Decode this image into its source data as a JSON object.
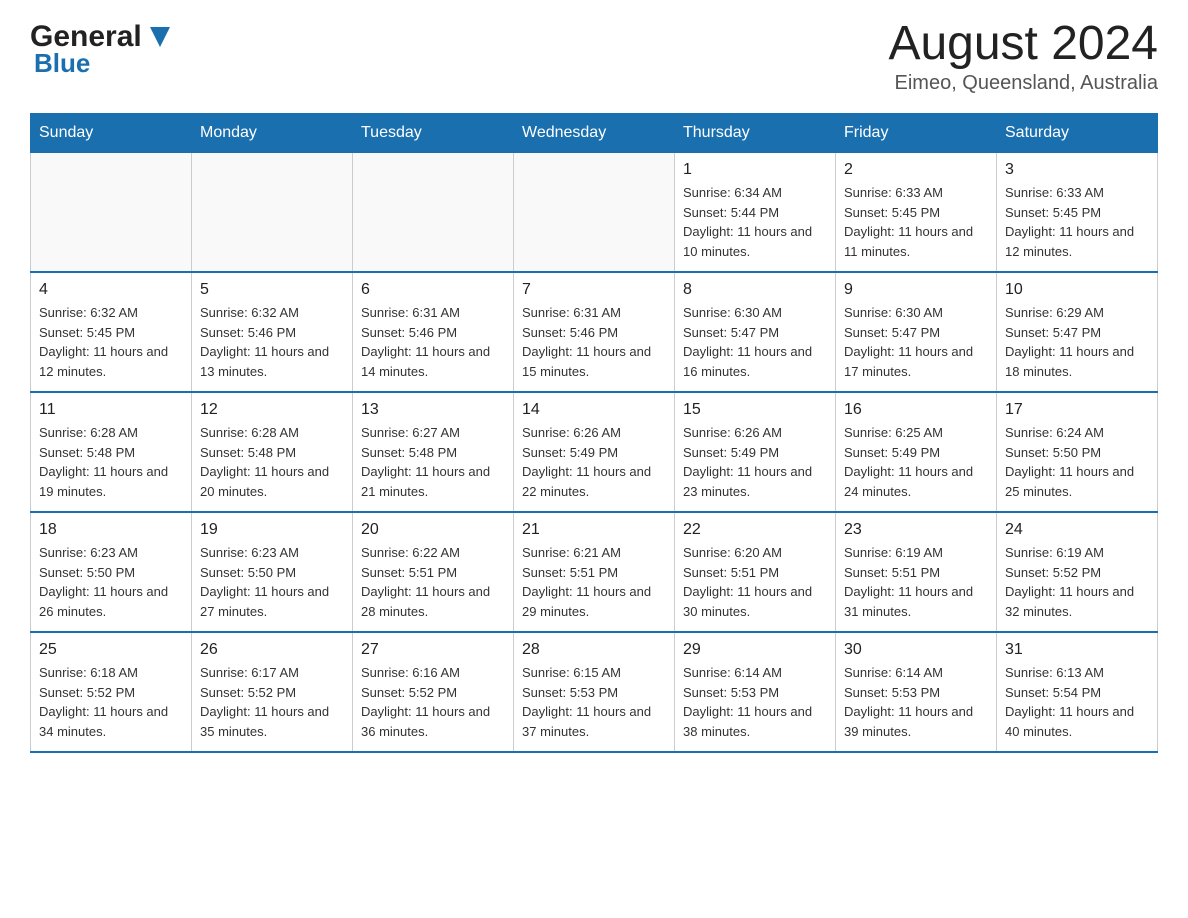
{
  "header": {
    "logo_general": "General",
    "logo_blue": "Blue",
    "month_title": "August 2024",
    "location": "Eimeo, Queensland, Australia"
  },
  "days_of_week": [
    "Sunday",
    "Monday",
    "Tuesday",
    "Wednesday",
    "Thursday",
    "Friday",
    "Saturday"
  ],
  "weeks": [
    {
      "days": [
        {
          "num": "",
          "info": ""
        },
        {
          "num": "",
          "info": ""
        },
        {
          "num": "",
          "info": ""
        },
        {
          "num": "",
          "info": ""
        },
        {
          "num": "1",
          "info": "Sunrise: 6:34 AM\nSunset: 5:44 PM\nDaylight: 11 hours and 10 minutes."
        },
        {
          "num": "2",
          "info": "Sunrise: 6:33 AM\nSunset: 5:45 PM\nDaylight: 11 hours and 11 minutes."
        },
        {
          "num": "3",
          "info": "Sunrise: 6:33 AM\nSunset: 5:45 PM\nDaylight: 11 hours and 12 minutes."
        }
      ]
    },
    {
      "days": [
        {
          "num": "4",
          "info": "Sunrise: 6:32 AM\nSunset: 5:45 PM\nDaylight: 11 hours and 12 minutes."
        },
        {
          "num": "5",
          "info": "Sunrise: 6:32 AM\nSunset: 5:46 PM\nDaylight: 11 hours and 13 minutes."
        },
        {
          "num": "6",
          "info": "Sunrise: 6:31 AM\nSunset: 5:46 PM\nDaylight: 11 hours and 14 minutes."
        },
        {
          "num": "7",
          "info": "Sunrise: 6:31 AM\nSunset: 5:46 PM\nDaylight: 11 hours and 15 minutes."
        },
        {
          "num": "8",
          "info": "Sunrise: 6:30 AM\nSunset: 5:47 PM\nDaylight: 11 hours and 16 minutes."
        },
        {
          "num": "9",
          "info": "Sunrise: 6:30 AM\nSunset: 5:47 PM\nDaylight: 11 hours and 17 minutes."
        },
        {
          "num": "10",
          "info": "Sunrise: 6:29 AM\nSunset: 5:47 PM\nDaylight: 11 hours and 18 minutes."
        }
      ]
    },
    {
      "days": [
        {
          "num": "11",
          "info": "Sunrise: 6:28 AM\nSunset: 5:48 PM\nDaylight: 11 hours and 19 minutes."
        },
        {
          "num": "12",
          "info": "Sunrise: 6:28 AM\nSunset: 5:48 PM\nDaylight: 11 hours and 20 minutes."
        },
        {
          "num": "13",
          "info": "Sunrise: 6:27 AM\nSunset: 5:48 PM\nDaylight: 11 hours and 21 minutes."
        },
        {
          "num": "14",
          "info": "Sunrise: 6:26 AM\nSunset: 5:49 PM\nDaylight: 11 hours and 22 minutes."
        },
        {
          "num": "15",
          "info": "Sunrise: 6:26 AM\nSunset: 5:49 PM\nDaylight: 11 hours and 23 minutes."
        },
        {
          "num": "16",
          "info": "Sunrise: 6:25 AM\nSunset: 5:49 PM\nDaylight: 11 hours and 24 minutes."
        },
        {
          "num": "17",
          "info": "Sunrise: 6:24 AM\nSunset: 5:50 PM\nDaylight: 11 hours and 25 minutes."
        }
      ]
    },
    {
      "days": [
        {
          "num": "18",
          "info": "Sunrise: 6:23 AM\nSunset: 5:50 PM\nDaylight: 11 hours and 26 minutes."
        },
        {
          "num": "19",
          "info": "Sunrise: 6:23 AM\nSunset: 5:50 PM\nDaylight: 11 hours and 27 minutes."
        },
        {
          "num": "20",
          "info": "Sunrise: 6:22 AM\nSunset: 5:51 PM\nDaylight: 11 hours and 28 minutes."
        },
        {
          "num": "21",
          "info": "Sunrise: 6:21 AM\nSunset: 5:51 PM\nDaylight: 11 hours and 29 minutes."
        },
        {
          "num": "22",
          "info": "Sunrise: 6:20 AM\nSunset: 5:51 PM\nDaylight: 11 hours and 30 minutes."
        },
        {
          "num": "23",
          "info": "Sunrise: 6:19 AM\nSunset: 5:51 PM\nDaylight: 11 hours and 31 minutes."
        },
        {
          "num": "24",
          "info": "Sunrise: 6:19 AM\nSunset: 5:52 PM\nDaylight: 11 hours and 32 minutes."
        }
      ]
    },
    {
      "days": [
        {
          "num": "25",
          "info": "Sunrise: 6:18 AM\nSunset: 5:52 PM\nDaylight: 11 hours and 34 minutes."
        },
        {
          "num": "26",
          "info": "Sunrise: 6:17 AM\nSunset: 5:52 PM\nDaylight: 11 hours and 35 minutes."
        },
        {
          "num": "27",
          "info": "Sunrise: 6:16 AM\nSunset: 5:52 PM\nDaylight: 11 hours and 36 minutes."
        },
        {
          "num": "28",
          "info": "Sunrise: 6:15 AM\nSunset: 5:53 PM\nDaylight: 11 hours and 37 minutes."
        },
        {
          "num": "29",
          "info": "Sunrise: 6:14 AM\nSunset: 5:53 PM\nDaylight: 11 hours and 38 minutes."
        },
        {
          "num": "30",
          "info": "Sunrise: 6:14 AM\nSunset: 5:53 PM\nDaylight: 11 hours and 39 minutes."
        },
        {
          "num": "31",
          "info": "Sunrise: 6:13 AM\nSunset: 5:54 PM\nDaylight: 11 hours and 40 minutes."
        }
      ]
    }
  ]
}
